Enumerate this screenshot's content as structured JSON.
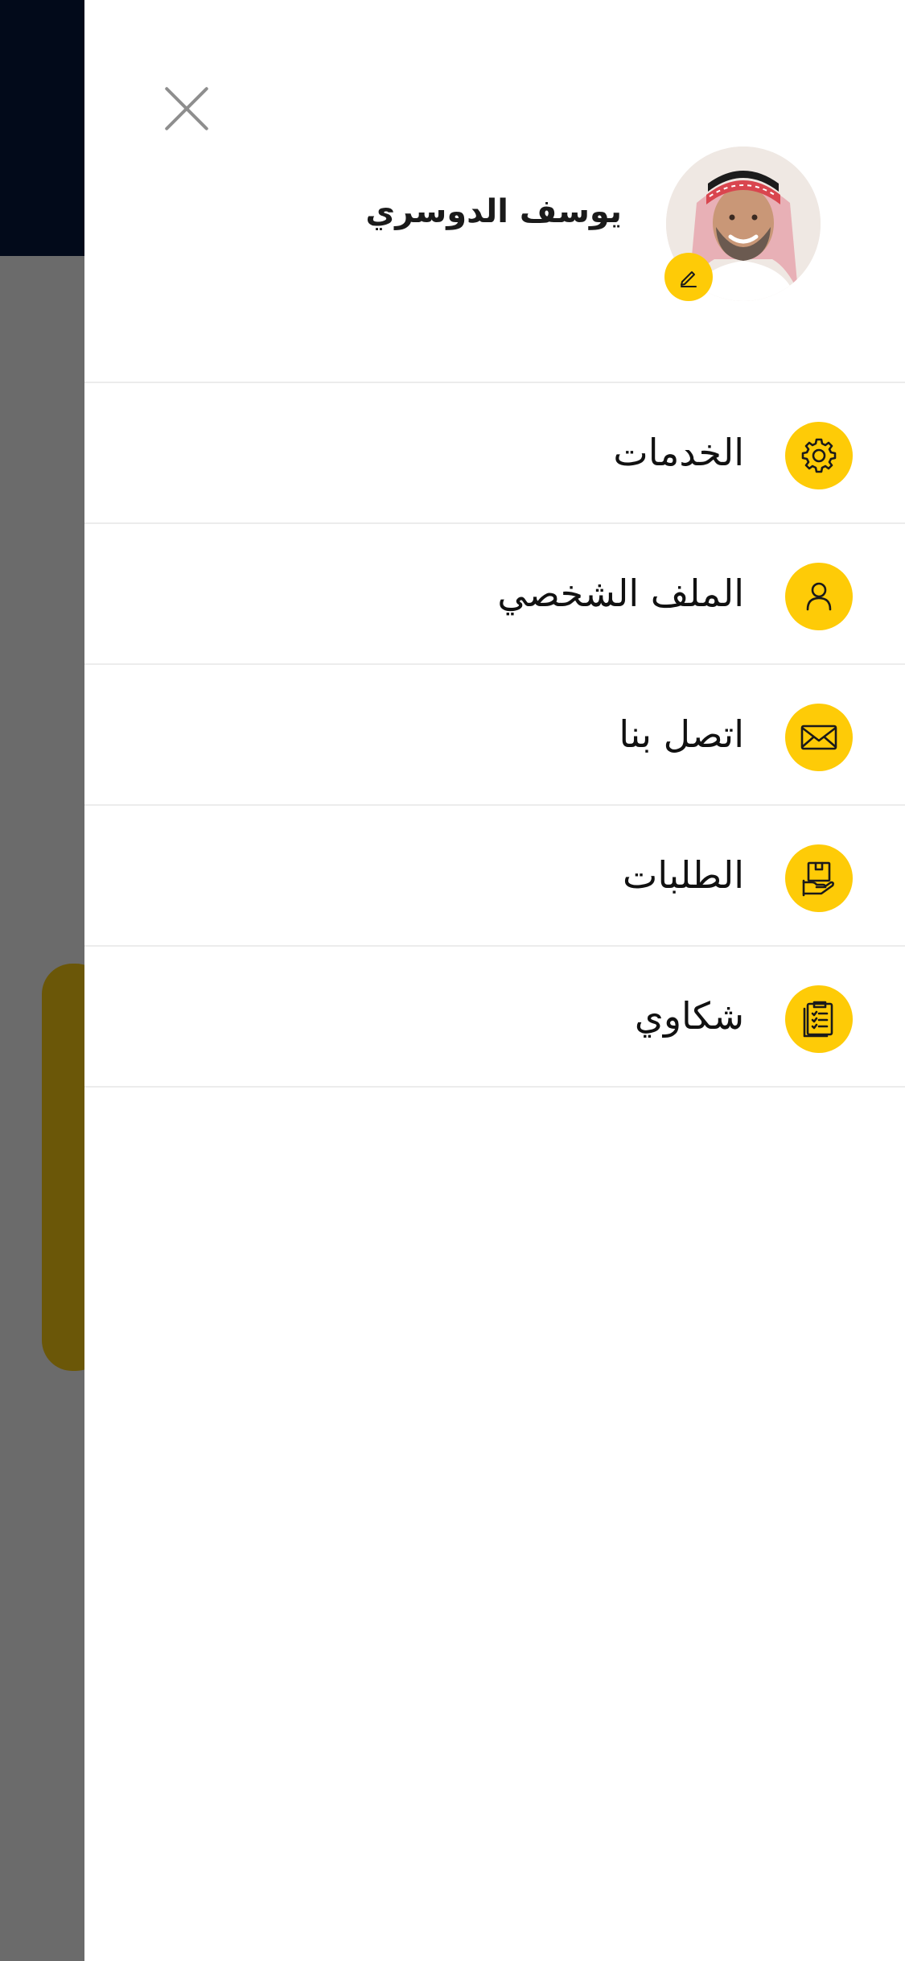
{
  "profile": {
    "name": "يوسف الدوسري"
  },
  "menu": {
    "items": [
      {
        "label": "الخدمات",
        "icon": "gear-icon"
      },
      {
        "label": "الملف الشخصي",
        "icon": "user-icon"
      },
      {
        "label": "اتصل بنا",
        "icon": "envelope-icon"
      },
      {
        "label": "الطلبات",
        "icon": "box-hand-icon"
      },
      {
        "label": "شكاوي",
        "icon": "clipboard-icon"
      }
    ]
  },
  "colors": {
    "accent": "#fecb07",
    "header_dark": "#020a1a",
    "overlay": "#6b6b6b",
    "divider": "#ececec"
  }
}
